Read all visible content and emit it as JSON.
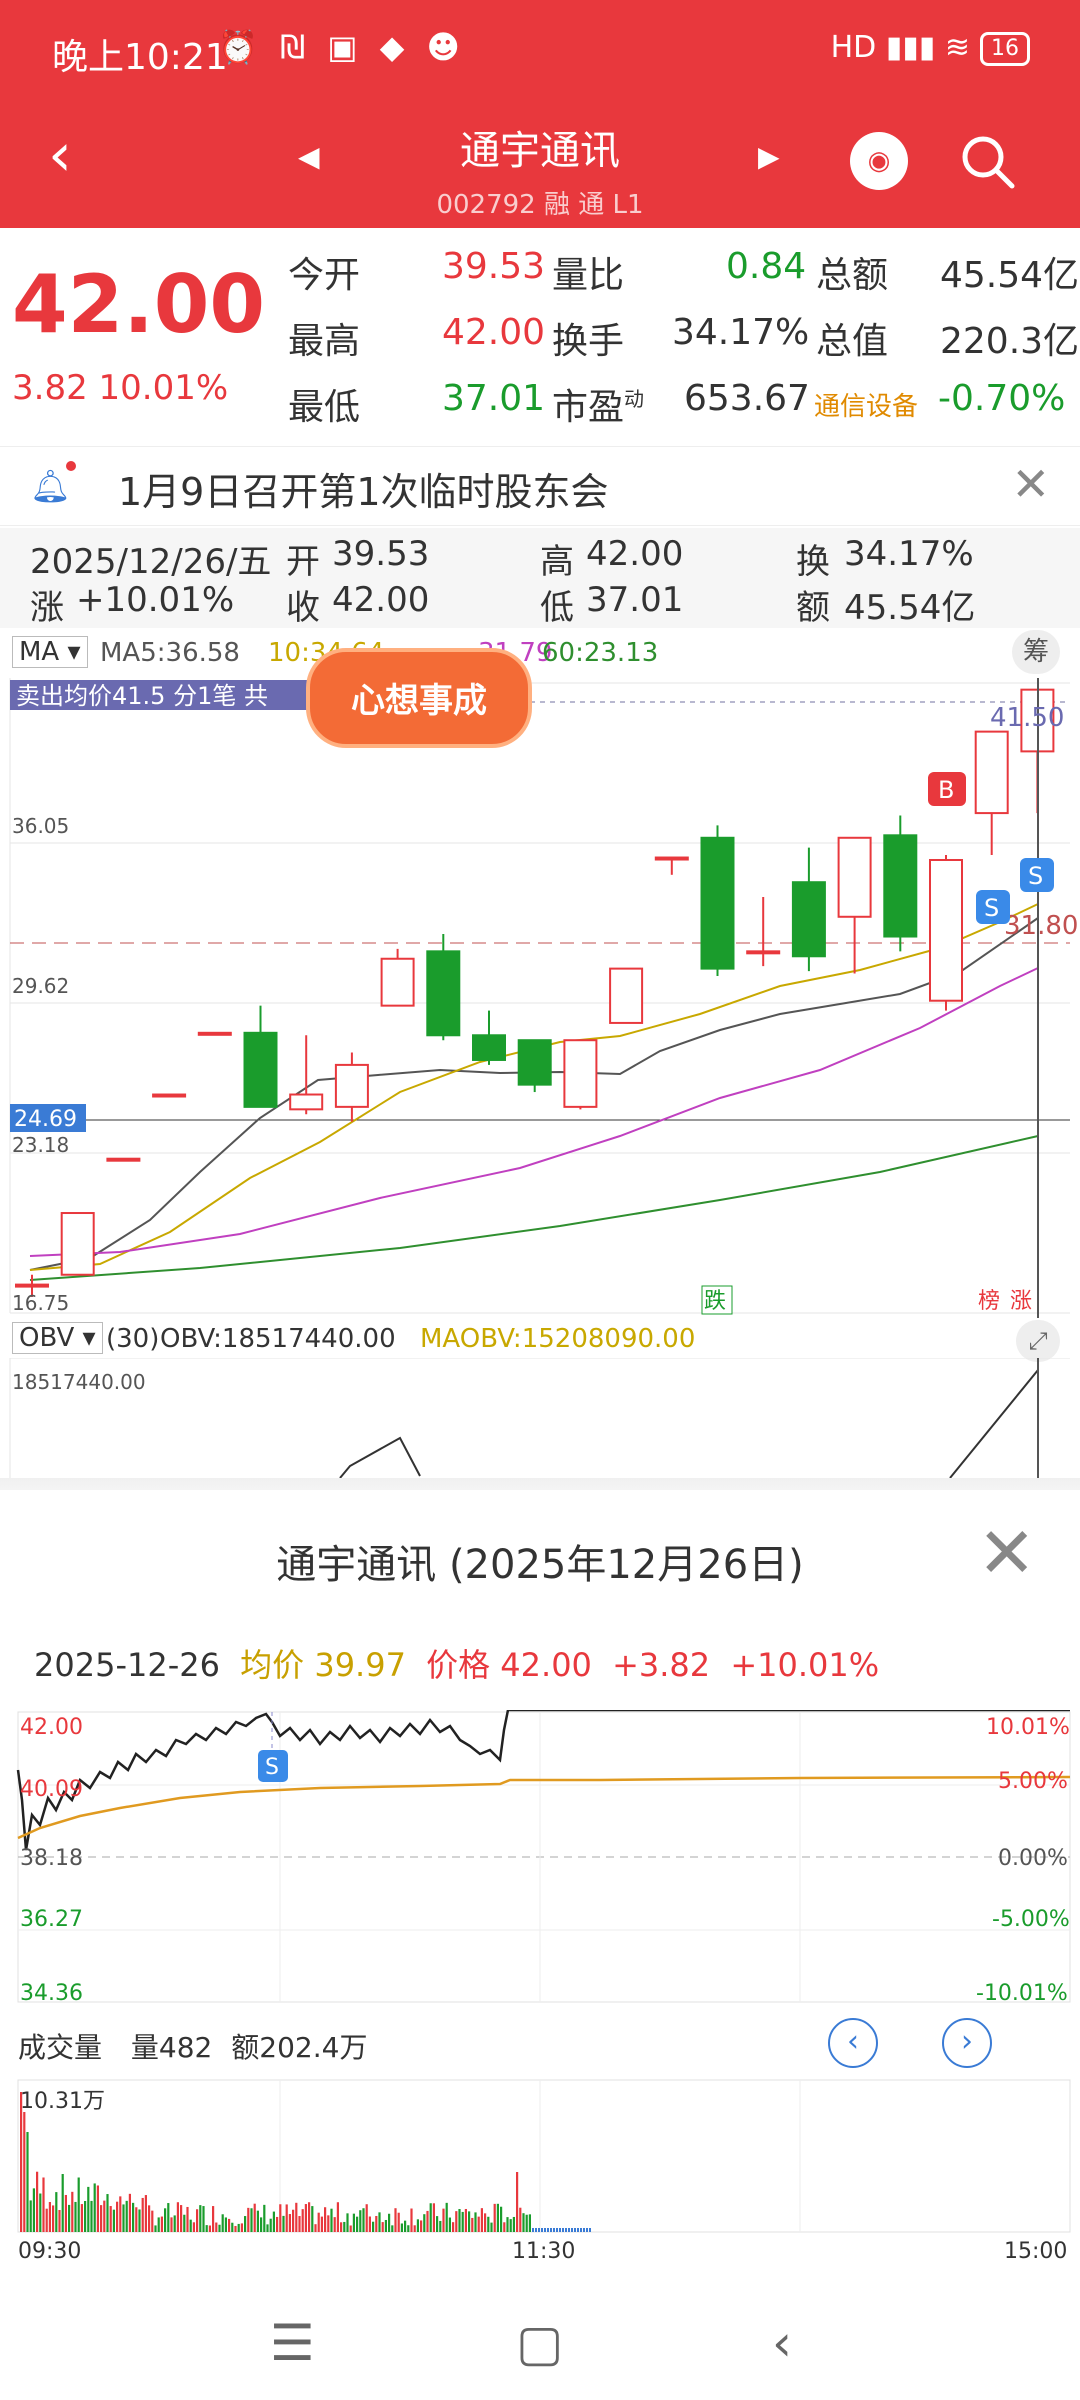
{
  "status_bar": {
    "time": "晚上10:21",
    "icons": "⏰ ₪ ▣ ◆ ☻",
    "right": "HD ▮▮▮ ≋",
    "battery": "16"
  },
  "header": {
    "title": "通宇通讯",
    "code": "002792",
    "badges": "融 通 L1"
  },
  "quote": {
    "price": "42.00",
    "change": "3.82",
    "change_pct": "10.01%",
    "open_label": "今开",
    "open": "39.53",
    "high_label": "最高",
    "high": "42.00",
    "low_label": "最低",
    "low": "37.01",
    "vr_label": "量比",
    "vr": "0.84",
    "turn_label": "换手",
    "turn": "34.17%",
    "pe_label": "市盈",
    "pe_sup": "动",
    "pe": "653.67",
    "amt_label": "总额",
    "amt": "45.54亿",
    "mcap_label": "总值",
    "mcap": "220.3亿",
    "sector": "通信设备",
    "sector_chg": "-0.70%"
  },
  "notice": {
    "text": "1月9日召开第1次临时股东会"
  },
  "ohlc": {
    "date": "2025/12/26/五",
    "open_l": "开",
    "open": "39.53",
    "high_l": "高",
    "high": "42.00",
    "turn_l": "换",
    "turn": "34.17%",
    "chg_l": "涨",
    "chg": "+10.01%",
    "close_l": "收",
    "close": "42.00",
    "low_l": "低",
    "low": "37.01",
    "amt_l": "额",
    "amt": "45.54亿"
  },
  "ma": {
    "label": "MA",
    "ma5": "MA5:36.58",
    "ma10": "10:34.64",
    "ma30": "31.79",
    "ma60": "60:23.13",
    "tool": "筹"
  },
  "kline": {
    "sell_note": "卖出均价41.5 分1笔 共",
    "y_labels": [
      "36.05",
      "29.62",
      "23.18",
      "16.75"
    ],
    "current_line": "24.69",
    "top_right": "41.50",
    "mid_right": "31.80",
    "tag_die": "跌",
    "tag_bang": "榜",
    "tag_zhang": "涨",
    "tiger_text": "心想事成",
    "b": "B",
    "s": "S",
    "candles": [
      {
        "o": 17.9,
        "c": 17.9,
        "h": 18.3,
        "l": 17.4
      },
      {
        "o": 18.3,
        "c": 20.8,
        "h": 20.8,
        "l": 18.3
      },
      {
        "o": 23.0,
        "c": 23.0,
        "h": 23.0,
        "l": 23.0
      },
      {
        "o": 25.6,
        "c": 25.6,
        "h": 25.6,
        "l": 25.6
      },
      {
        "o": 28.1,
        "c": 28.1,
        "h": 28.1,
        "l": 28.1
      },
      {
        "o": 28.1,
        "c": 25.1,
        "h": 29.2,
        "l": 25.1
      },
      {
        "o": 25.0,
        "c": 25.6,
        "h": 28.0,
        "l": 24.8
      },
      {
        "o": 25.1,
        "c": 26.8,
        "h": 27.3,
        "l": 24.5
      },
      {
        "o": 29.2,
        "c": 31.1,
        "h": 31.5,
        "l": 29.2
      },
      {
        "o": 31.4,
        "c": 28.0,
        "h": 32.1,
        "l": 27.8
      },
      {
        "o": 28.0,
        "c": 27.0,
        "h": 29.0,
        "l": 26.8
      },
      {
        "o": 27.8,
        "c": 26.0,
        "h": 27.8,
        "l": 25.7
      },
      {
        "o": 25.1,
        "c": 27.8,
        "h": 27.8,
        "l": 25.0
      },
      {
        "o": 28.5,
        "c": 30.7,
        "h": 30.7,
        "l": 28.5
      },
      {
        "o": 35.2,
        "c": 35.2,
        "h": 35.2,
        "l": 34.5
      },
      {
        "o": 36.0,
        "c": 30.7,
        "h": 36.5,
        "l": 30.4
      },
      {
        "o": 31.4,
        "c": 31.4,
        "h": 33.6,
        "l": 30.8
      },
      {
        "o": 34.2,
        "c": 31.2,
        "h": 35.6,
        "l": 30.6
      },
      {
        "o": 32.8,
        "c": 36.0,
        "h": 36.0,
        "l": 30.5
      },
      {
        "o": 36.1,
        "c": 32.0,
        "h": 36.9,
        "l": 31.4
      },
      {
        "o": 29.4,
        "c": 35.1,
        "h": 35.3,
        "l": 29.0
      },
      {
        "o": 37.0,
        "c": 40.3,
        "h": 40.3,
        "l": 35.3
      },
      {
        "o": 39.5,
        "c": 42.0,
        "h": 42.0,
        "l": 37.0
      }
    ]
  },
  "obv": {
    "label": "OBV",
    "params": "(30)",
    "obv": "OBV:18517440.00",
    "maobv": "MAOBV:15208090.00",
    "y_label": "18517440.00"
  },
  "panel": {
    "title": "通宇通讯 (2025年12月26日)",
    "date": "2025-12-26",
    "avg_label": "均价",
    "avg": "39.97",
    "price_label": "价格",
    "price": "42.00",
    "chg": "+3.82",
    "chg_pct": "+10.01%",
    "y_left": [
      "42.00",
      "40.09",
      "38.18",
      "36.27",
      "34.36"
    ],
    "y_right": [
      "10.01%",
      "5.00%",
      "0.00%",
      "-5.00%",
      "-10.01%"
    ],
    "vol_label": "成交量",
    "vol": "量482",
    "amt": "额202.4万",
    "vol_max": "10.31万",
    "times": [
      "09:30",
      "11:30",
      "15:00"
    ],
    "s": "S"
  },
  "colors": {
    "brand": "#e8383d",
    "up": "#e8383d",
    "down": "#1a9c2c",
    "ma5": "#555555",
    "ma10": "#c8a800",
    "ma30": "#c040c0",
    "ma60": "#2f8f2f",
    "avg": "#e09a20"
  }
}
